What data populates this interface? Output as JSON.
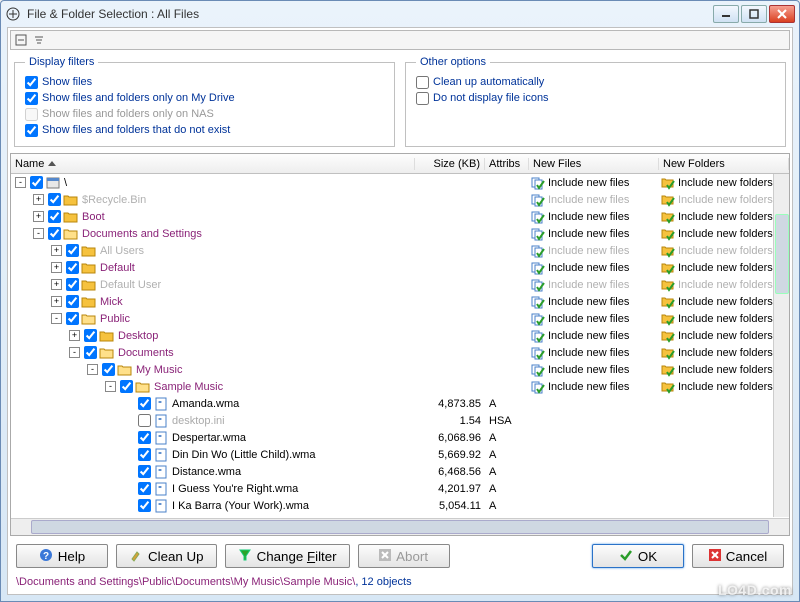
{
  "window": {
    "title": "File & Folder Selection : All Files"
  },
  "toolbar": {
    "icons": [
      "collapse-icon",
      "filter-icon"
    ]
  },
  "filters": {
    "legend": "Display filters",
    "show_files": "Show files",
    "show_drive": "Show files and folders only on My Drive",
    "show_nas": "Show files and folders only on NAS",
    "show_notexist": "Show files and folders that do not exist"
  },
  "other": {
    "legend": "Other options",
    "cleanup": "Clean up automatically",
    "noicons": "Do not display file icons"
  },
  "columns": {
    "name": "Name",
    "size": "Size (KB)",
    "attribs": "Attribs",
    "newfiles": "New Files",
    "newfolders": "New Folders"
  },
  "inc_files_label": "Include new files",
  "inc_folders_label": "Include new folders",
  "rows": [
    {
      "indent": 0,
      "type": "root",
      "expander": "-",
      "checked": true,
      "label": "\\",
      "special": false,
      "inc": true,
      "faded": false
    },
    {
      "indent": 1,
      "type": "folder",
      "expander": "+",
      "checked": true,
      "label": "$Recycle.Bin",
      "special": true,
      "inc": true,
      "faded": true
    },
    {
      "indent": 1,
      "type": "folder",
      "expander": "+",
      "checked": true,
      "label": "Boot",
      "special": true,
      "inc": true,
      "faded": false
    },
    {
      "indent": 1,
      "type": "folder",
      "expander": "-",
      "checked": true,
      "label": "Documents and Settings",
      "special": true,
      "inc": true,
      "faded": false
    },
    {
      "indent": 2,
      "type": "folder",
      "expander": "+",
      "checked": true,
      "label": "All Users",
      "special": true,
      "inc": true,
      "faded": true
    },
    {
      "indent": 2,
      "type": "folder",
      "expander": "+",
      "checked": true,
      "label": "Default",
      "special": true,
      "inc": true,
      "faded": false
    },
    {
      "indent": 2,
      "type": "folder",
      "expander": "+",
      "checked": true,
      "label": "Default User",
      "special": true,
      "inc": true,
      "faded": true
    },
    {
      "indent": 2,
      "type": "folder",
      "expander": "+",
      "checked": true,
      "label": "Mick",
      "special": true,
      "inc": true,
      "faded": false
    },
    {
      "indent": 2,
      "type": "folder",
      "expander": "-",
      "checked": true,
      "label": "Public",
      "special": true,
      "inc": true,
      "faded": false
    },
    {
      "indent": 3,
      "type": "folder",
      "expander": "+",
      "checked": true,
      "label": "Desktop",
      "special": true,
      "inc": true,
      "faded": false
    },
    {
      "indent": 3,
      "type": "folder",
      "expander": "-",
      "checked": true,
      "label": "Documents",
      "special": true,
      "inc": true,
      "faded": false
    },
    {
      "indent": 4,
      "type": "folder",
      "expander": "-",
      "checked": true,
      "label": "My Music",
      "special": true,
      "inc": true,
      "faded": false
    },
    {
      "indent": 5,
      "type": "folder",
      "expander": "-",
      "checked": true,
      "label": "Sample Music",
      "special": true,
      "inc": true,
      "faded": false
    },
    {
      "indent": 6,
      "type": "file",
      "expander": "",
      "checked": true,
      "label": "Amanda.wma",
      "size": "4,873.85",
      "attr": "A"
    },
    {
      "indent": 6,
      "type": "file",
      "expander": "",
      "checked": false,
      "label": "desktop.ini",
      "disabled": true,
      "size": "1.54",
      "attr": "HSA"
    },
    {
      "indent": 6,
      "type": "file",
      "expander": "",
      "checked": true,
      "label": "Despertar.wma",
      "size": "6,068.96",
      "attr": "A"
    },
    {
      "indent": 6,
      "type": "file",
      "expander": "",
      "checked": true,
      "label": "Din Din Wo (Little Child).wma",
      "size": "5,669.92",
      "attr": "A"
    },
    {
      "indent": 6,
      "type": "file",
      "expander": "",
      "checked": true,
      "label": "Distance.wma",
      "size": "6,468.56",
      "attr": "A"
    },
    {
      "indent": 6,
      "type": "file",
      "expander": "",
      "checked": true,
      "label": "I Guess You're Right.wma",
      "size": "4,201.97",
      "attr": "A"
    },
    {
      "indent": 6,
      "type": "file",
      "expander": "",
      "checked": true,
      "label": "I Ka Barra (Your Work).wma",
      "size": "5,054.11",
      "attr": "A"
    }
  ],
  "buttons": {
    "help": "Help",
    "cleanup": "Clean Up",
    "filter": "Change Filter",
    "abort": "Abort",
    "ok": "OK",
    "cancel": "Cancel"
  },
  "status": {
    "path": "\\Documents and Settings\\Public\\Documents\\My Music\\Sample Music\\",
    "count": ", 12 objects"
  },
  "watermark": "LO4D.com"
}
